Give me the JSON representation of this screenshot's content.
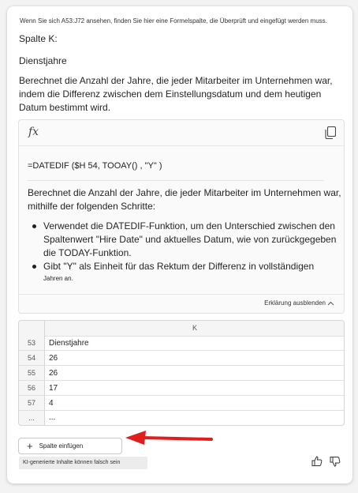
{
  "intro_text": "Wenn Sie sich A53:J72 ansehen, finden Sie hier eine Formelspalte, die Überprüft und eingefügt werden muss.",
  "column_heading": "Spalte K:",
  "column_title": "Dienstjahre",
  "description": "Berechnet die Anzahl der Jahre, die jeder Mitarbeiter im Unternehmen war, indem die Differenz zwischen dem Einstellungsdatum und dem heutigen Datum bestimmt wird.",
  "formula_box": {
    "fx_symbol": "fx",
    "formula": "=DATEDIF ($H 54, TOOAY() , \"Y\" )",
    "explanation": "Berechnet die Anzahl der Jahre, die jeder Mitarbeiter im Unternehmen war, mithilfe der folgenden Schritte:",
    "bullets": [
      "Verwendet die DATEDIF-Funktion, um den Unterschied zwischen den Spaltenwert \"Hire Date\" und aktuelles Datum, wie von zurückgegeben die TODAY-Funktion.",
      "Gibt \"Y\" als Einheit für das Rektum der Differenz in vollständigen"
    ],
    "bullet_tail": "Jahren an.",
    "collapse_label": "Erklärung ausblenden"
  },
  "preview": {
    "column_letter": "K",
    "rows": [
      {
        "num": "53",
        "value": "Dienstjahre"
      },
      {
        "num": "54",
        "value": "26"
      },
      {
        "num": "55",
        "value": "26"
      },
      {
        "num": "56",
        "value": "17"
      },
      {
        "num": "57",
        "value": "4"
      },
      {
        "num": "...",
        "value": "..."
      }
    ]
  },
  "insert_button": "Spalte einfügen",
  "ai_disclaimer": "KI-generierte Inhalte können falsch sein",
  "icons": {
    "fx": "function-icon",
    "copy": "copy-icon",
    "chevron": "chevron-up-icon",
    "plus": "plus-icon",
    "thumbs_up": "thumbs-up-icon",
    "thumbs_down": "thumbs-down-icon",
    "arrow": "red-arrow-annotation"
  },
  "colors": {
    "arrow": "#e01e1e"
  }
}
